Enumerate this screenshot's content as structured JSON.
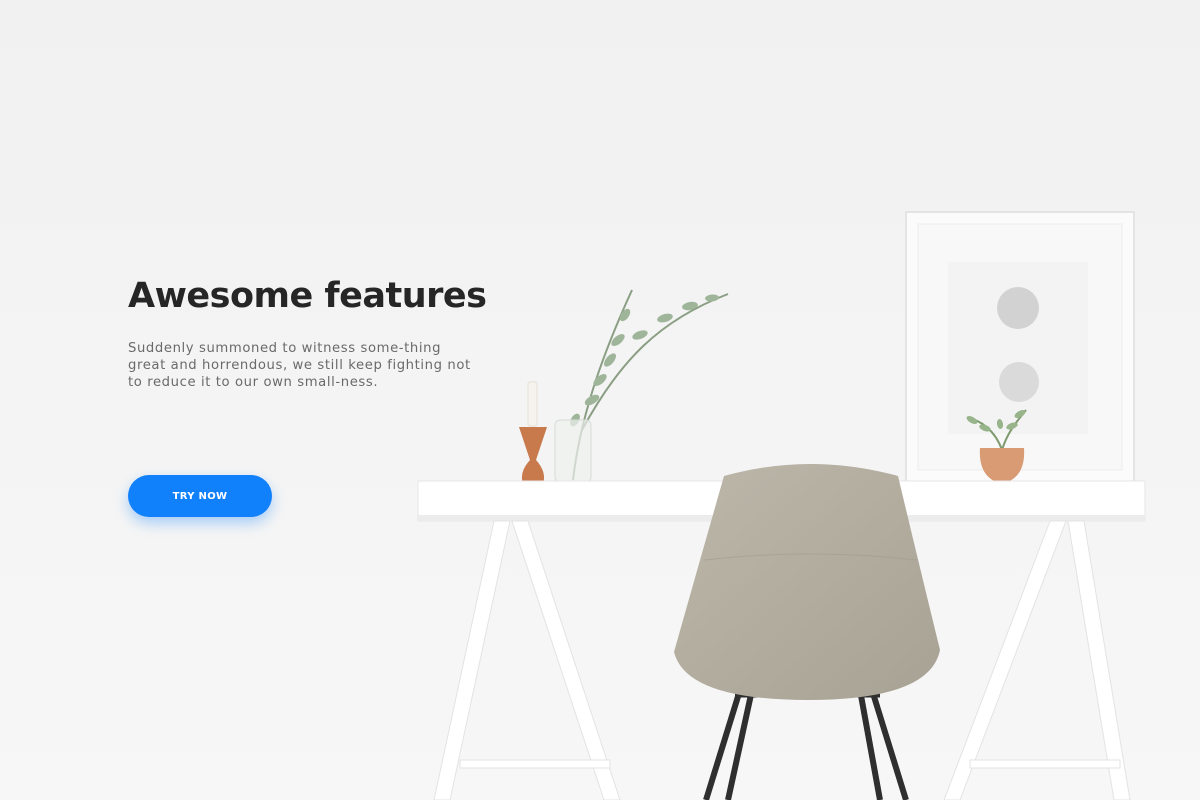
{
  "hero": {
    "title": "Awesome features",
    "text": "Suddenly summoned to witness some-thing great and horrendous, we still keep fighting not to reduce it to our own small-ness.",
    "cta_label": "TRY NOW"
  },
  "colors": {
    "background": "#f4f4f4",
    "accent": "#1180fb",
    "title": "#262626",
    "body_text": "#6a6a6a"
  }
}
